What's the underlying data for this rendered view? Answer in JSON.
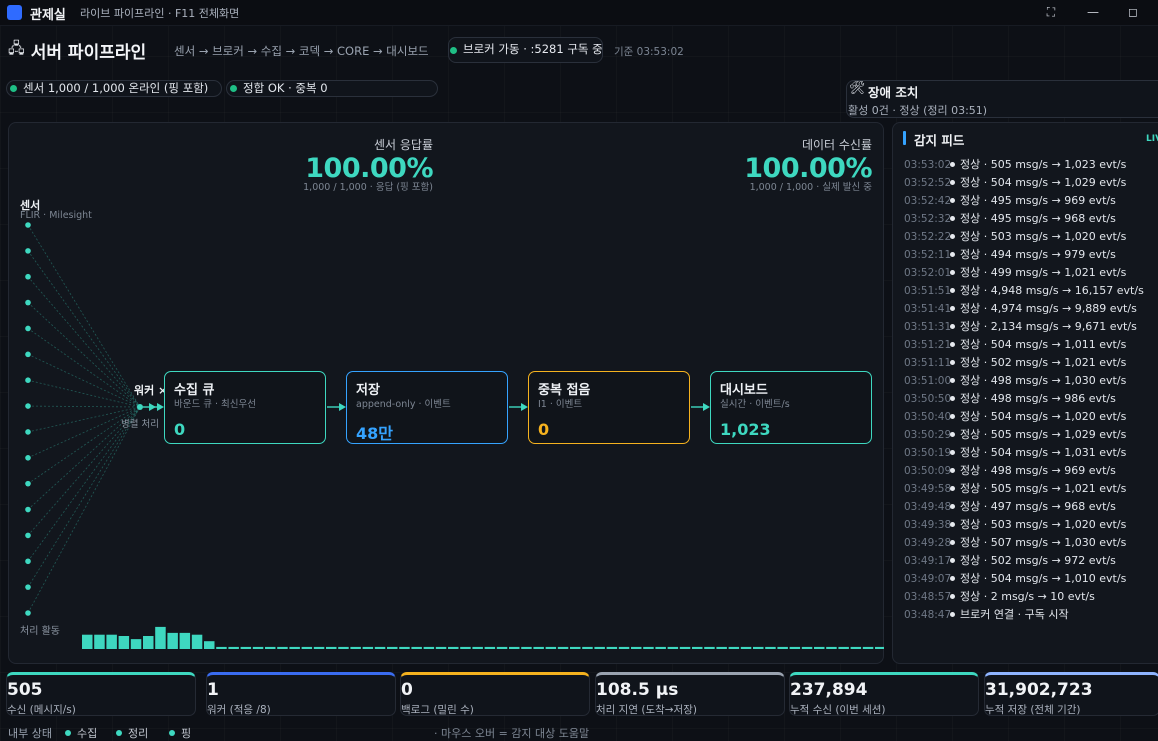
{
  "window": {
    "app_title": "관제실",
    "subtitle": "라이브 파이프라인 · F11 전체화면",
    "fullscreen_glyph": "⛶",
    "minimize_glyph": "—",
    "maximize_glyph": "◻"
  },
  "header": {
    "title_icon": "🖧",
    "title": "서버 파이프라인",
    "breadcrumb": "센서 → 브로커 → 수집 → 코덱 → CORE → 대시보드",
    "broker_status": "브로커 가동 · :5281 구독 중",
    "as_of": "기준 03:53:02"
  },
  "chips": {
    "sensors": "센서 1,000 / 1,000 온라인 (핑 포함)",
    "integrity": "정합 OK · 중복 0"
  },
  "fault": {
    "icon": "🛠",
    "title": "장애 조치",
    "status": "활성 0건 · 정상 (정리 03:51)"
  },
  "kpis": {
    "sensor_response": {
      "label": "센서 응답률",
      "value": "100.00%",
      "sub": "1,000 / 1,000 · 응답 (핑 포함)"
    },
    "data_reception": {
      "label": "데이터 수신률",
      "value": "100.00%",
      "sub": "1,000 / 1,000 · 실제 발신 중"
    }
  },
  "flow": {
    "sensor_label": "센서",
    "sensor_sub": "FLIR · Milesight",
    "worker_label": "워커 ×",
    "worker_sub": "병렬 처리",
    "activity_label": "처리 활동",
    "sensor_node_count": 16,
    "activity_levels": [
      0.55,
      0.55,
      0.55,
      0.5,
      0.38,
      0.5,
      0.85,
      0.62,
      0.62,
      0.55,
      0.3,
      0.08,
      0.08,
      0.08,
      0.08,
      0.08,
      0.08,
      0.08,
      0.08,
      0.08,
      0.08,
      0.08,
      0.08,
      0.08,
      0.08,
      0.08,
      0.08,
      0.08,
      0.08,
      0.08,
      0.08,
      0.08,
      0.08,
      0.08,
      0.08,
      0.08,
      0.08,
      0.08,
      0.08,
      0.08,
      0.08,
      0.08,
      0.08,
      0.08,
      0.08,
      0.08,
      0.08,
      0.08,
      0.08,
      0.08,
      0.08,
      0.08,
      0.08,
      0.08,
      0.08,
      0.08,
      0.08,
      0.08,
      0.08,
      0.08,
      0.08,
      0.08,
      0.08,
      0.08,
      0.08,
      0.08
    ]
  },
  "stages": [
    {
      "title": "수집 큐",
      "sub": "바운드 큐 · 최신우선",
      "value": "0",
      "color": "#3ed8c0"
    },
    {
      "title": "저장",
      "sub": "append-only · 이벤트",
      "value": "48만",
      "color": "#35a3ff"
    },
    {
      "title": "중복 접음",
      "sub": "I1 · 이벤트",
      "value": "0",
      "color": "#f5b21f"
    },
    {
      "title": "대시보드",
      "sub": "실시간 · 이벤트/s",
      "value": "1,023",
      "color": "#3ed8c0"
    }
  ],
  "feed": {
    "title": "감지 피드",
    "live": "LIVE",
    "items": [
      {
        "time": "03:53:02",
        "text": "정상 · 505 msg/s → 1,023 evt/s"
      },
      {
        "time": "03:52:52",
        "text": "정상 · 504 msg/s → 1,029 evt/s"
      },
      {
        "time": "03:52:42",
        "text": "정상 · 495 msg/s → 969 evt/s"
      },
      {
        "time": "03:52:32",
        "text": "정상 · 495 msg/s → 968 evt/s"
      },
      {
        "time": "03:52:22",
        "text": "정상 · 503 msg/s → 1,020 evt/s"
      },
      {
        "time": "03:52:11",
        "text": "정상 · 494 msg/s → 979 evt/s"
      },
      {
        "time": "03:52:01",
        "text": "정상 · 499 msg/s → 1,021 evt/s"
      },
      {
        "time": "03:51:51",
        "text": "정상 · 4,948 msg/s → 16,157 evt/s"
      },
      {
        "time": "03:51:41",
        "text": "정상 · 4,974 msg/s → 9,889 evt/s"
      },
      {
        "time": "03:51:31",
        "text": "정상 · 2,134 msg/s → 9,671 evt/s"
      },
      {
        "time": "03:51:21",
        "text": "정상 · 504 msg/s → 1,011 evt/s"
      },
      {
        "time": "03:51:11",
        "text": "정상 · 502 msg/s → 1,021 evt/s"
      },
      {
        "time": "03:51:00",
        "text": "정상 · 498 msg/s → 1,030 evt/s"
      },
      {
        "time": "03:50:50",
        "text": "정상 · 498 msg/s → 986 evt/s"
      },
      {
        "time": "03:50:40",
        "text": "정상 · 504 msg/s → 1,020 evt/s"
      },
      {
        "time": "03:50:29",
        "text": "정상 · 505 msg/s → 1,029 evt/s"
      },
      {
        "time": "03:50:19",
        "text": "정상 · 504 msg/s → 1,031 evt/s"
      },
      {
        "time": "03:50:09",
        "text": "정상 · 498 msg/s → 969 evt/s"
      },
      {
        "time": "03:49:58",
        "text": "정상 · 505 msg/s → 1,021 evt/s"
      },
      {
        "time": "03:49:48",
        "text": "정상 · 497 msg/s → 968 evt/s"
      },
      {
        "time": "03:49:38",
        "text": "정상 · 503 msg/s → 1,020 evt/s"
      },
      {
        "time": "03:49:28",
        "text": "정상 · 507 msg/s → 1,030 evt/s"
      },
      {
        "time": "03:49:17",
        "text": "정상 · 502 msg/s → 972 evt/s"
      },
      {
        "time": "03:49:07",
        "text": "정상 · 504 msg/s → 1,010 evt/s"
      },
      {
        "time": "03:48:57",
        "text": "정상 · 2 msg/s → 10 evt/s"
      },
      {
        "time": "03:48:47",
        "text": "브로커 연결 · 구독 시작"
      }
    ]
  },
  "stats": [
    {
      "value": "505",
      "label": "수신 (메시지/s)",
      "color": "#3ed8c0"
    },
    {
      "value": "1",
      "label": "워커 (적응 /8)",
      "color": "#3a6cf0"
    },
    {
      "value": "0",
      "label": "백로그 (밀린 수)",
      "color": "#f5b21f"
    },
    {
      "value": "108.5 μs",
      "label": "처리 지연 (도착→저장)",
      "color": "#9aa3b0"
    },
    {
      "value": "237,894",
      "label": "누적 수신 (이번 세션)",
      "color": "#3ed8c0"
    },
    {
      "value": "31,902,723",
      "label": "누적 저장 (전체 기간)",
      "color": "#8fb4ff"
    }
  ],
  "footer": {
    "internal_state": "내부 상태",
    "legend": [
      "수집",
      "정리",
      "핑"
    ],
    "hint": "· 마우스 오버 = 감지 대상 도움말"
  },
  "colors": {
    "accent_teal": "#3ed8c0",
    "accent_blue": "#35a3ff",
    "accent_amber": "#f5b21f",
    "status_ok": "#1fbf86"
  }
}
